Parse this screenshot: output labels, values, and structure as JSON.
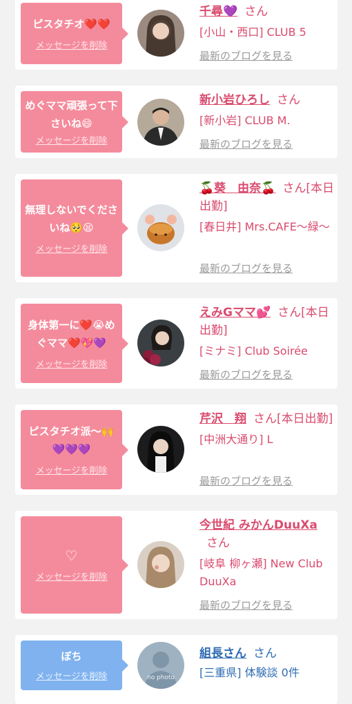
{
  "colors": {
    "pink": "#f48b9c",
    "blue": "#7fb2ee",
    "name_pink": "#d94b6e",
    "name_blue": "#2f6cb3",
    "blog_gray": "#9a9a9a"
  },
  "common": {
    "delete_label": "メッセージを削除",
    "blog_label": "最新のブログを見る"
  },
  "cards": [
    {
      "message": "ピスタチオ❤️❤️",
      "name": "千尋💜",
      "honorific": "さん",
      "shop": "[小山・西口] CLUB 5",
      "avatar_icon": "woman-portrait-icon"
    },
    {
      "message": "めぐママ頑張って下さいね😄",
      "name": "新小岩ひろし",
      "honorific": "さん",
      "shop": "[新小岩] CLUB M.",
      "avatar_icon": "man-in-suit-icon"
    },
    {
      "message": "無理しないでくださいね🥺😫",
      "name": "🍒葵　由奈🍒",
      "honorific": "さん[本日出勤]",
      "shop": "[春日井] Mrs.CAFE～緑～",
      "avatar_icon": "pie-with-ears-icon"
    },
    {
      "message": "身体第一に❤️😭めぐママ❤️💖💜",
      "name": "えみGママ💕",
      "honorific": "さん[本日出勤]",
      "shop": "[ミナミ] Club Soirée",
      "avatar_icon": "woman-with-flowers-icon"
    },
    {
      "message": "ピスタチオ派〜🙌💜💜💜",
      "name": "芹沢　翔",
      "honorific": "さん[本日出勤]",
      "shop": "[中洲大通り] L",
      "avatar_icon": "woman-portrait-icon"
    },
    {
      "message": "♡",
      "name": "今世紀 みかんDuuXa",
      "honorific": "さん",
      "shop": "[岐阜 柳ヶ瀬] New Club DuuXa",
      "avatar_icon": "woman-portrait-icon"
    },
    {
      "message": "ぼち",
      "name": "組長さん",
      "honorific": "さん",
      "shop": "[三重県] 体験談 0件",
      "avatar_icon": "no-photo-icon",
      "avatar_text": "no photo"
    }
  ]
}
